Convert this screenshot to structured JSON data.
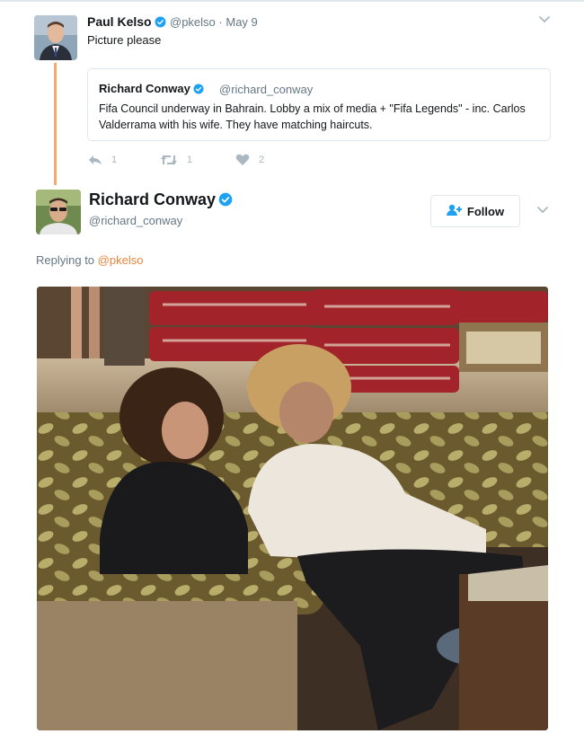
{
  "tweet": {
    "author_name": "Paul Kelso",
    "author_handle": "@pkelso",
    "separator": "·",
    "date": "May 9",
    "text": "Picture please",
    "verified_icon": "verified-badge-icon",
    "menu_icon": "chevron-down-icon",
    "avatar_icon": "profile-photo"
  },
  "quoted_tweet": {
    "author_name": "Richard Conway",
    "author_handle": "@richard_conway",
    "text": "Fifa Council underway in Bahrain. Lobby a mix of media + \"Fifa Legends\" - inc. Carlos Valderrama with his wife. They have matching haircuts."
  },
  "actions": {
    "reply_count": "1",
    "retweet_count": "1",
    "like_count": "2",
    "reply_icon": "reply-icon",
    "retweet_icon": "retweet-icon",
    "like_icon": "heart-icon"
  },
  "reply": {
    "author_name": "Richard Conway",
    "author_handle": "@richard_conway",
    "follow_label": "Follow",
    "replying_prefix": "Replying to",
    "replying_to": "@pkelso",
    "media_icon": "photo-image"
  },
  "colors": {
    "verified": "#1da1f2",
    "thread_line": "#f7a96b",
    "link": "#e8853d",
    "muted": "#657786",
    "action_icon": "#aab8c2"
  }
}
